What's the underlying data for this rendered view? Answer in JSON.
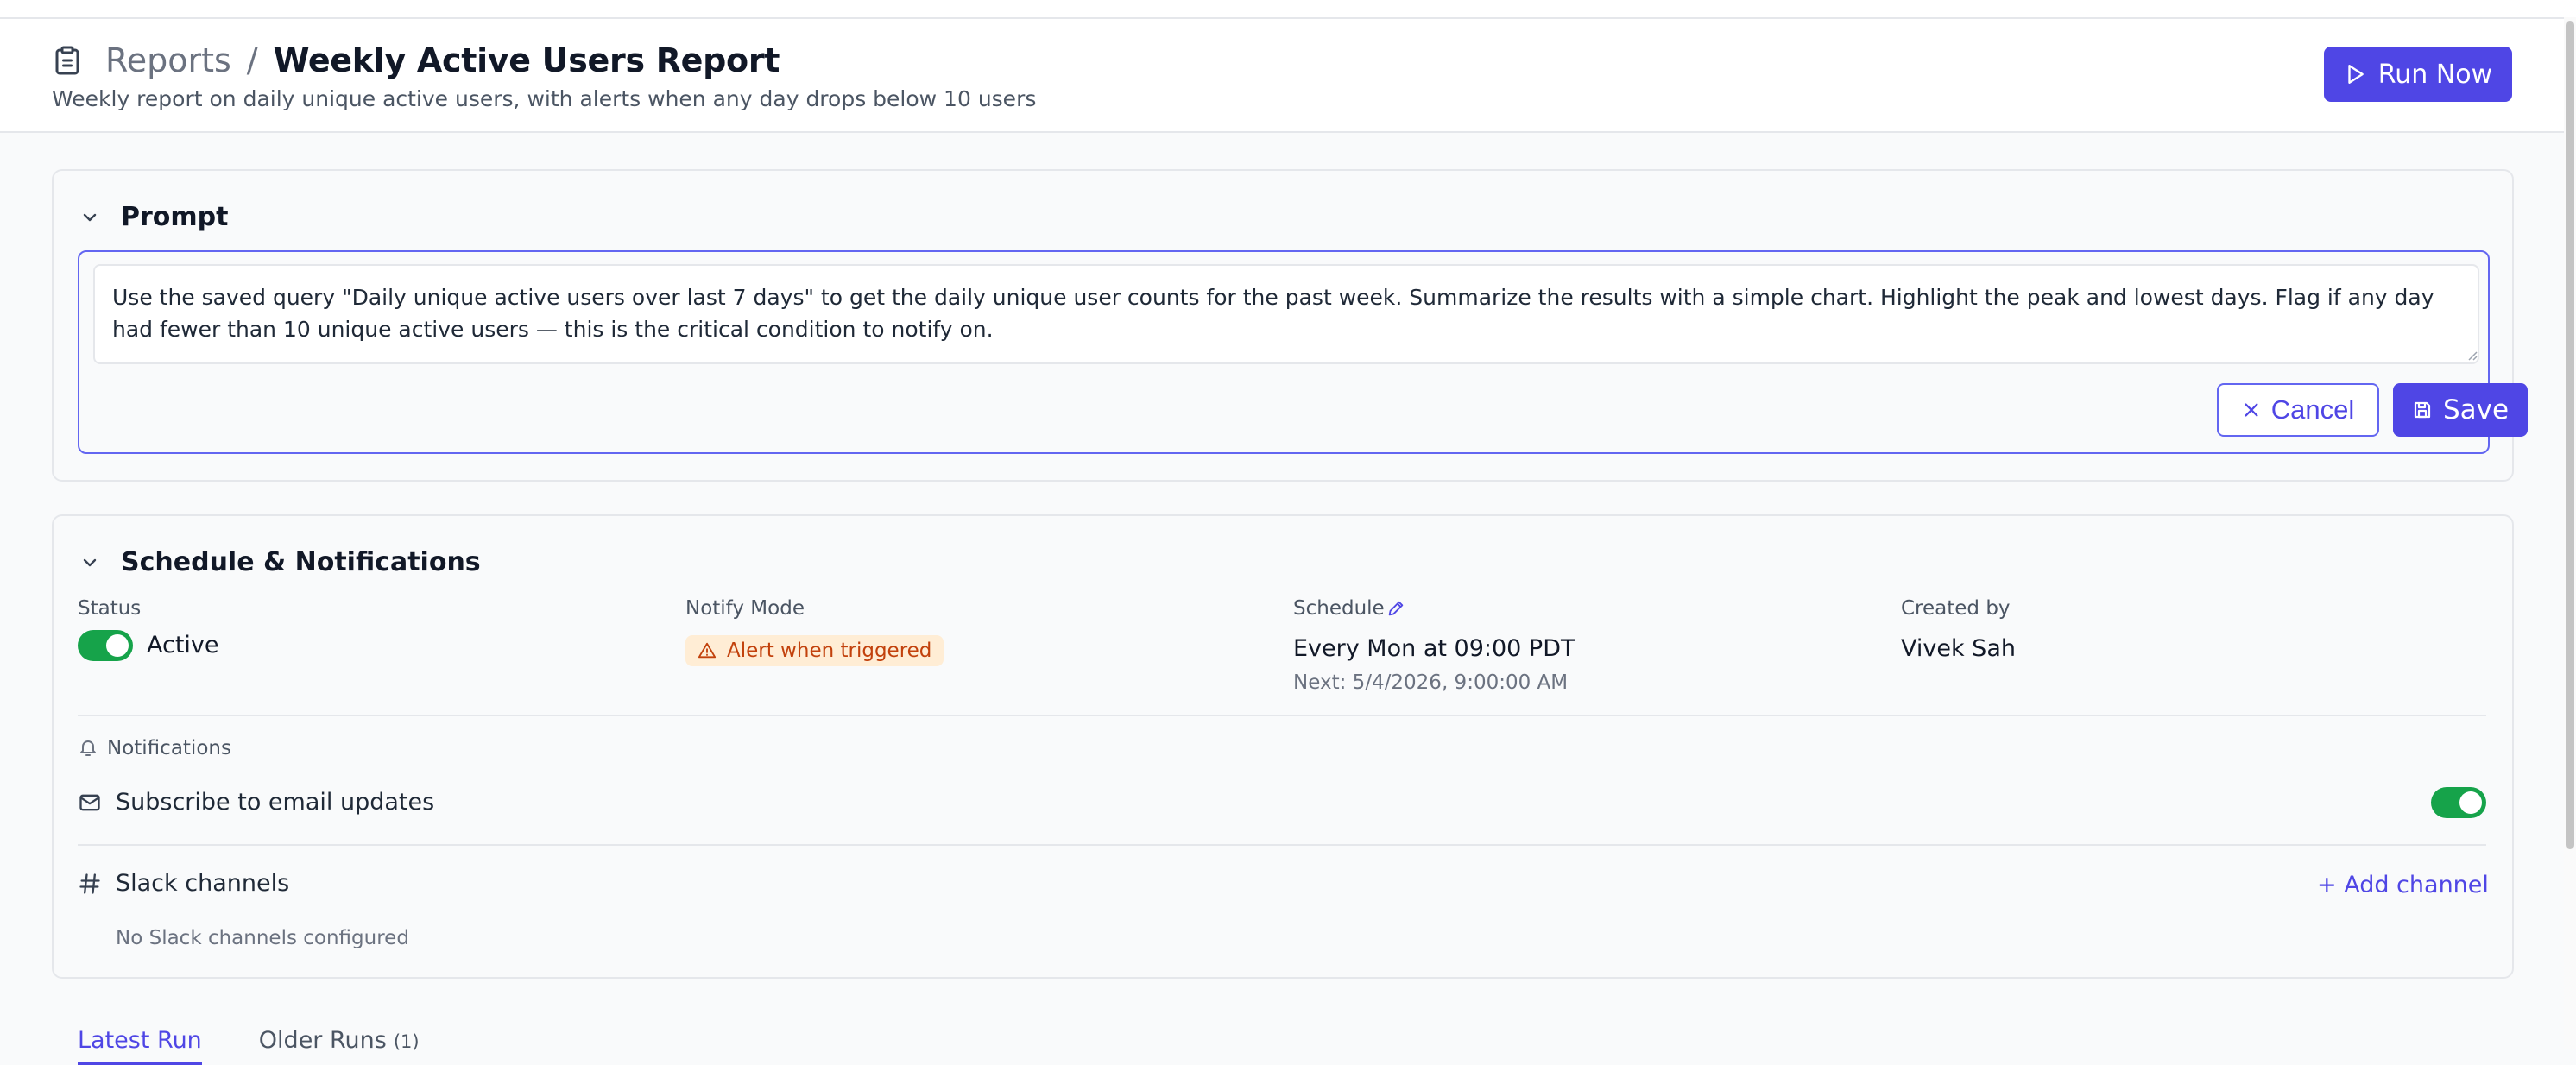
{
  "header": {
    "breadcrumb_parent": "Reports",
    "breadcrumb_separator": "/",
    "title": "Weekly Active Users Report",
    "subtitle": "Weekly report on daily unique active users, with alerts when any day drops below 10 users",
    "run_now_label": "Run Now"
  },
  "prompt": {
    "section_title": "Prompt",
    "text": "Use the saved query \"Daily unique active users over last 7 days\" to get the daily unique user counts for the past week. Summarize the results with a simple chart. Highlight the peak and lowest days. Flag if any day had fewer than 10 unique active users — this is the critical condition to notify on.",
    "cancel_label": "Cancel",
    "save_label": "Save"
  },
  "schedule": {
    "section_title": "Schedule & Notifications",
    "status_label": "Status",
    "status_value": "Active",
    "status_on": true,
    "notify_mode_label": "Notify Mode",
    "notify_mode_value": "Alert when triggered",
    "schedule_label": "Schedule",
    "schedule_value": "Every Mon at 09:00 PDT",
    "next_run": "Next: 5/4/2026, 9:00:00 AM",
    "created_by_label": "Created by",
    "created_by_value": "Vivek Sah",
    "notifications_label": "Notifications",
    "email_label": "Subscribe to email updates",
    "email_on": true,
    "slack_label": "Slack channels",
    "add_channel_label": "+ Add channel",
    "slack_empty": "No Slack channels configured"
  },
  "tabs": {
    "latest_run": "Latest Run",
    "older_runs": "Older Runs",
    "older_runs_count": "(1)"
  },
  "colors": {
    "accent": "#4f46e5",
    "toggle_on": "#16a34a",
    "badge_bg": "#ffedd5",
    "badge_text": "#c2410c"
  },
  "icons": [
    "clipboard-icon",
    "play-icon",
    "chevron-down-icon",
    "close-icon",
    "save-icon",
    "pencil-icon",
    "alert-triangle-icon",
    "bell-icon",
    "mail-icon",
    "hash-icon"
  ]
}
